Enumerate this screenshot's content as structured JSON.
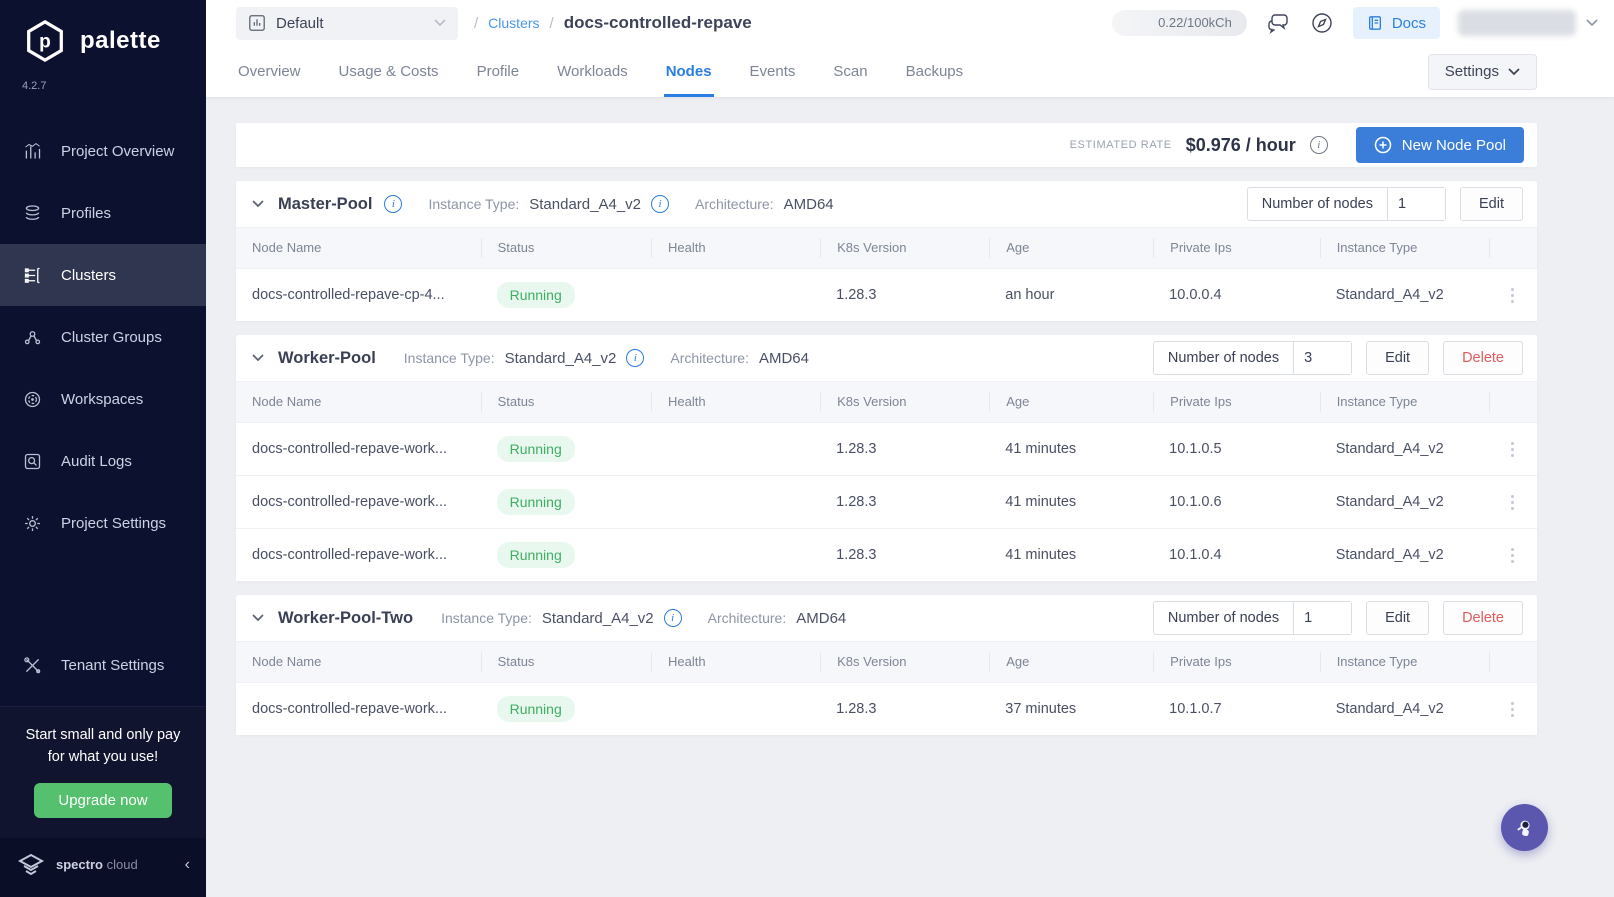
{
  "app": {
    "name": "palette",
    "version": "4.2.7"
  },
  "sidebar": {
    "items": [
      {
        "label": "Project Overview"
      },
      {
        "label": "Profiles"
      },
      {
        "label": "Clusters"
      },
      {
        "label": "Cluster Groups"
      },
      {
        "label": "Workspaces"
      },
      {
        "label": "Audit Logs"
      },
      {
        "label": "Project Settings"
      },
      {
        "label": "Tenant Settings"
      }
    ],
    "upsell": {
      "text_line1": "Start small and only pay",
      "text_line2": "for what you use!",
      "button_label": "Upgrade now"
    },
    "brand": {
      "name_bold": "spectro",
      "name_light": "cloud"
    }
  },
  "topbar": {
    "project_selector": {
      "value": "Default"
    },
    "breadcrumb": {
      "sep": "/",
      "root": "Clusters",
      "current": "docs-controlled-repave"
    },
    "usage_badge": "0.22/100kCh",
    "docs_button": "Docs"
  },
  "tabs": {
    "labels": [
      "Overview",
      "Usage & Costs",
      "Profile",
      "Workloads",
      "Nodes",
      "Events",
      "Scan",
      "Backups"
    ],
    "active": "Nodes",
    "settings_button": "Settings"
  },
  "rate_bar": {
    "label": "ESTIMATED RATE",
    "value": "$0.976 / hour",
    "new_node_pool_button": "New Node Pool"
  },
  "labels": {
    "instance_type": "Instance Type:",
    "architecture": "Architecture:",
    "number_of_nodes": "Number of nodes",
    "edit": "Edit",
    "delete": "Delete",
    "info_glyph": "i"
  },
  "columns": [
    "Node Name",
    "Status",
    "Health",
    "K8s Version",
    "Age",
    "Private Ips",
    "Instance Type"
  ],
  "pools": [
    {
      "name": "Master-Pool",
      "instance_type": "Standard_A4_v2",
      "architecture": "AMD64",
      "nodes_count": "1",
      "rows": [
        {
          "name": "docs-controlled-repave-cp-4...",
          "status": "Running",
          "k8s_version": "1.28.3",
          "age": "an hour",
          "private_ip": "10.0.0.4",
          "instance_type": "Standard_A4_v2"
        }
      ]
    },
    {
      "name": "Worker-Pool",
      "instance_type": "Standard_A4_v2",
      "architecture": "AMD64",
      "nodes_count": "3",
      "rows": [
        {
          "name": "docs-controlled-repave-work...",
          "status": "Running",
          "k8s_version": "1.28.3",
          "age": "41 minutes",
          "private_ip": "10.1.0.5",
          "instance_type": "Standard_A4_v2"
        },
        {
          "name": "docs-controlled-repave-work...",
          "status": "Running",
          "k8s_version": "1.28.3",
          "age": "41 minutes",
          "private_ip": "10.1.0.6",
          "instance_type": "Standard_A4_v2"
        },
        {
          "name": "docs-controlled-repave-work...",
          "status": "Running",
          "k8s_version": "1.28.3",
          "age": "41 minutes",
          "private_ip": "10.1.0.4",
          "instance_type": "Standard_A4_v2"
        }
      ]
    },
    {
      "name": "Worker-Pool-Two",
      "instance_type": "Standard_A4_v2",
      "architecture": "AMD64",
      "nodes_count": "1",
      "rows": [
        {
          "name": "docs-controlled-repave-work...",
          "status": "Running",
          "k8s_version": "1.28.3",
          "age": "37 minutes",
          "private_ip": "10.1.0.7",
          "instance_type": "Standard_A4_v2"
        }
      ]
    }
  ],
  "colors": {
    "accent_blue": "#2a7de2",
    "status_green": "#3cb964",
    "danger_red": "#e05c5c",
    "sidebar_bg": "#0d1130",
    "upgrade_green": "#55c06d",
    "fab_purple": "#5b57ae"
  }
}
